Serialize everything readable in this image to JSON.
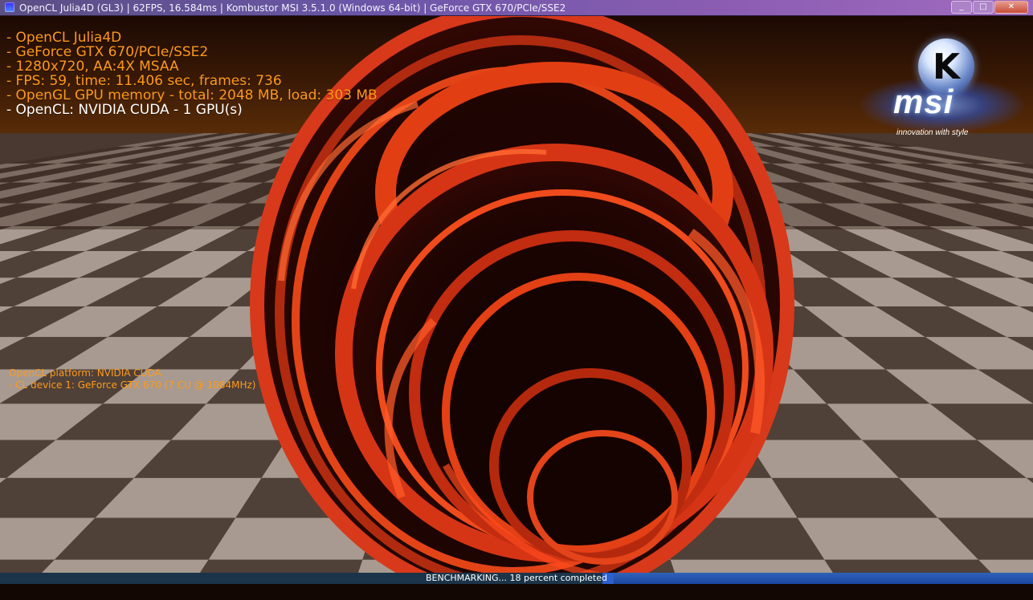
{
  "window": {
    "title": "OpenCL Julia4D (GL3) | 62FPS, 16.584ms | Kombustor MSI 3.5.1.0 (Windows 64-bit) | GeForce GTX 670/PCIe/SSE2",
    "minimize_glyph": "_",
    "maximize_glyph": "□",
    "close_glyph": "✕"
  },
  "hud": {
    "lines": [
      "- OpenCL Julia4D",
      "- GeForce GTX 670/PCIe/SSE2",
      "- 1280x720, AA:4X MSAA",
      "- FPS: 59, time: 11.406 sec, frames: 736",
      "- OpenGL GPU memory - total: 2048 MB, load: 303 MB",
      "- OpenCL: NVIDIA CUDA - 1 GPU(s)"
    ]
  },
  "cl_info": {
    "platform": "OpenCL platform: NVIDIA CUDA",
    "device": " - CL device 1: GeForce GTX 670 (7 CU @ 1084MHz)"
  },
  "logo": {
    "badge_letter": "K",
    "brand": "msi",
    "tagline": "innovation with style"
  },
  "progress": {
    "label": "BENCHMARKING... 18 percent completed",
    "percent": 18
  },
  "colors": {
    "hud_text": "#ff9a1a",
    "hud_emphasis": "#ffffff",
    "fractal_red": "#e33a12",
    "fractal_dark": "#1a0402",
    "floor_light": "#a89a90",
    "floor_dark": "#4f4038",
    "progress_blue": "#2c5fcf"
  }
}
